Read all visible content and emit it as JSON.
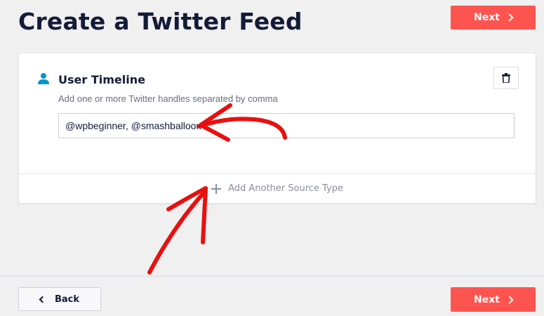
{
  "header": {
    "title": "Create a Twitter Feed",
    "next_label": "Next"
  },
  "source_card": {
    "icon": "user-icon",
    "title": "User Timeline",
    "description": "Add one or more Twitter handles separated by comma",
    "handles_value": "@wpbeginner, @smashballoon",
    "delete_icon": "trash-icon",
    "add_source_label": "Add Another Source Type"
  },
  "footer": {
    "back_label": "Back",
    "next_label": "Next"
  },
  "colors": {
    "accent": "#fe544f",
    "title": "#141b38",
    "icon": "#0096cc",
    "annotation": "#e8100f"
  }
}
